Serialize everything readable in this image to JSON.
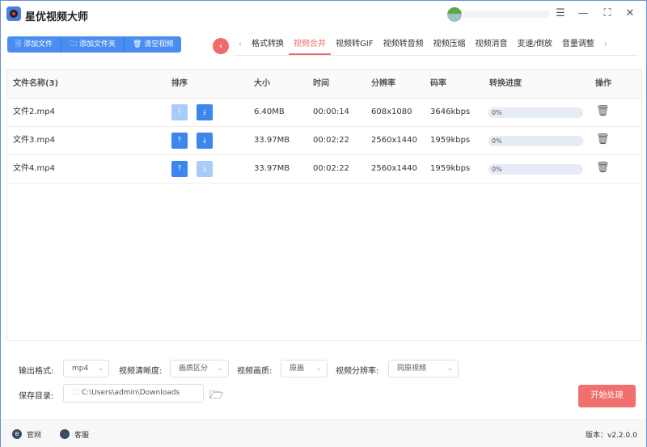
{
  "app": {
    "title": "星优视频大师"
  },
  "toolbar": {
    "add_file": "添加文件",
    "add_folder": "添加文件夹",
    "clear": "清空视频"
  },
  "tabs": [
    "格式转换",
    "视频合并",
    "视频转GIF",
    "视频转音频",
    "视频压缩",
    "视频消音",
    "变速/倒放",
    "音量调整"
  ],
  "active_tab": "视频合并",
  "table": {
    "headers": {
      "name": "文件名称(3)",
      "sort": "排序",
      "size": "大小",
      "time": "时间",
      "res": "分辨率",
      "bitrate": "码率",
      "progress": "转换进度",
      "action": "操作"
    },
    "rows": [
      {
        "name": "文件2.mp4",
        "size": "6.40MB",
        "time": "00:00:14",
        "res": "608x1080",
        "bitrate": "3646kbps",
        "progress": "0%"
      },
      {
        "name": "文件3.mp4",
        "size": "33.97MB",
        "time": "00:02:22",
        "res": "2560x1440",
        "bitrate": "1959kbps",
        "progress": "0%"
      },
      {
        "name": "文件4.mp4",
        "size": "33.97MB",
        "time": "00:02:22",
        "res": "2560x1440",
        "bitrate": "1959kbps",
        "progress": "0%"
      }
    ]
  },
  "settings": {
    "format_label": "输出格式:",
    "format": "mp4",
    "clarity_label": "视频清晰度:",
    "clarity": "画质区分",
    "quality_label": "视频画质:",
    "quality": "原画",
    "res_label": "视频分辨率:",
    "res": "同原视频",
    "dir_label": "保存目录:",
    "dir": "C:\\Users\\admin\\Downloads",
    "start": "开始处理"
  },
  "footer": {
    "site": "官网",
    "service": "客服",
    "version": "版本：v2.2.0.0"
  },
  "colors": {
    "accent": "#f06a6a",
    "primary": "#4a8df0"
  }
}
